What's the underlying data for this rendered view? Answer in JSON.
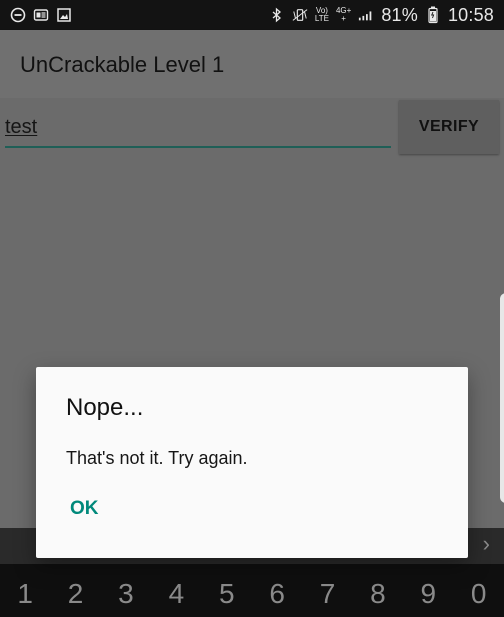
{
  "status_bar": {
    "left_icons": [
      "do-not-disturb-icon",
      "mail-badge-icon",
      "image-icon"
    ],
    "vo_lte_top": "Vo)",
    "vo_lte_bottom": "LTE",
    "network_top": "4G+",
    "network_bottom": "+",
    "battery_percent": "81%",
    "time": "10:58",
    "icon_names": [
      "bluetooth-icon",
      "vibrate-icon",
      "signal-icon",
      "battery-icon"
    ]
  },
  "app_bar": {
    "title": "UnCrackable Level 1"
  },
  "main": {
    "input_value": "test",
    "verify_label": "VERIFY"
  },
  "dialog": {
    "title": "Nope...",
    "message": "That's not it. Try again.",
    "ok_label": "OK"
  },
  "keyboard": {
    "keys": [
      "1",
      "2",
      "3",
      "4",
      "5",
      "6",
      "7",
      "8",
      "9",
      "0"
    ],
    "arrow_icon": "chevron-right-icon"
  },
  "colors": {
    "accent": "#00897b",
    "input_underline": "#1f5f57",
    "dialog_background": "#fafafa"
  }
}
